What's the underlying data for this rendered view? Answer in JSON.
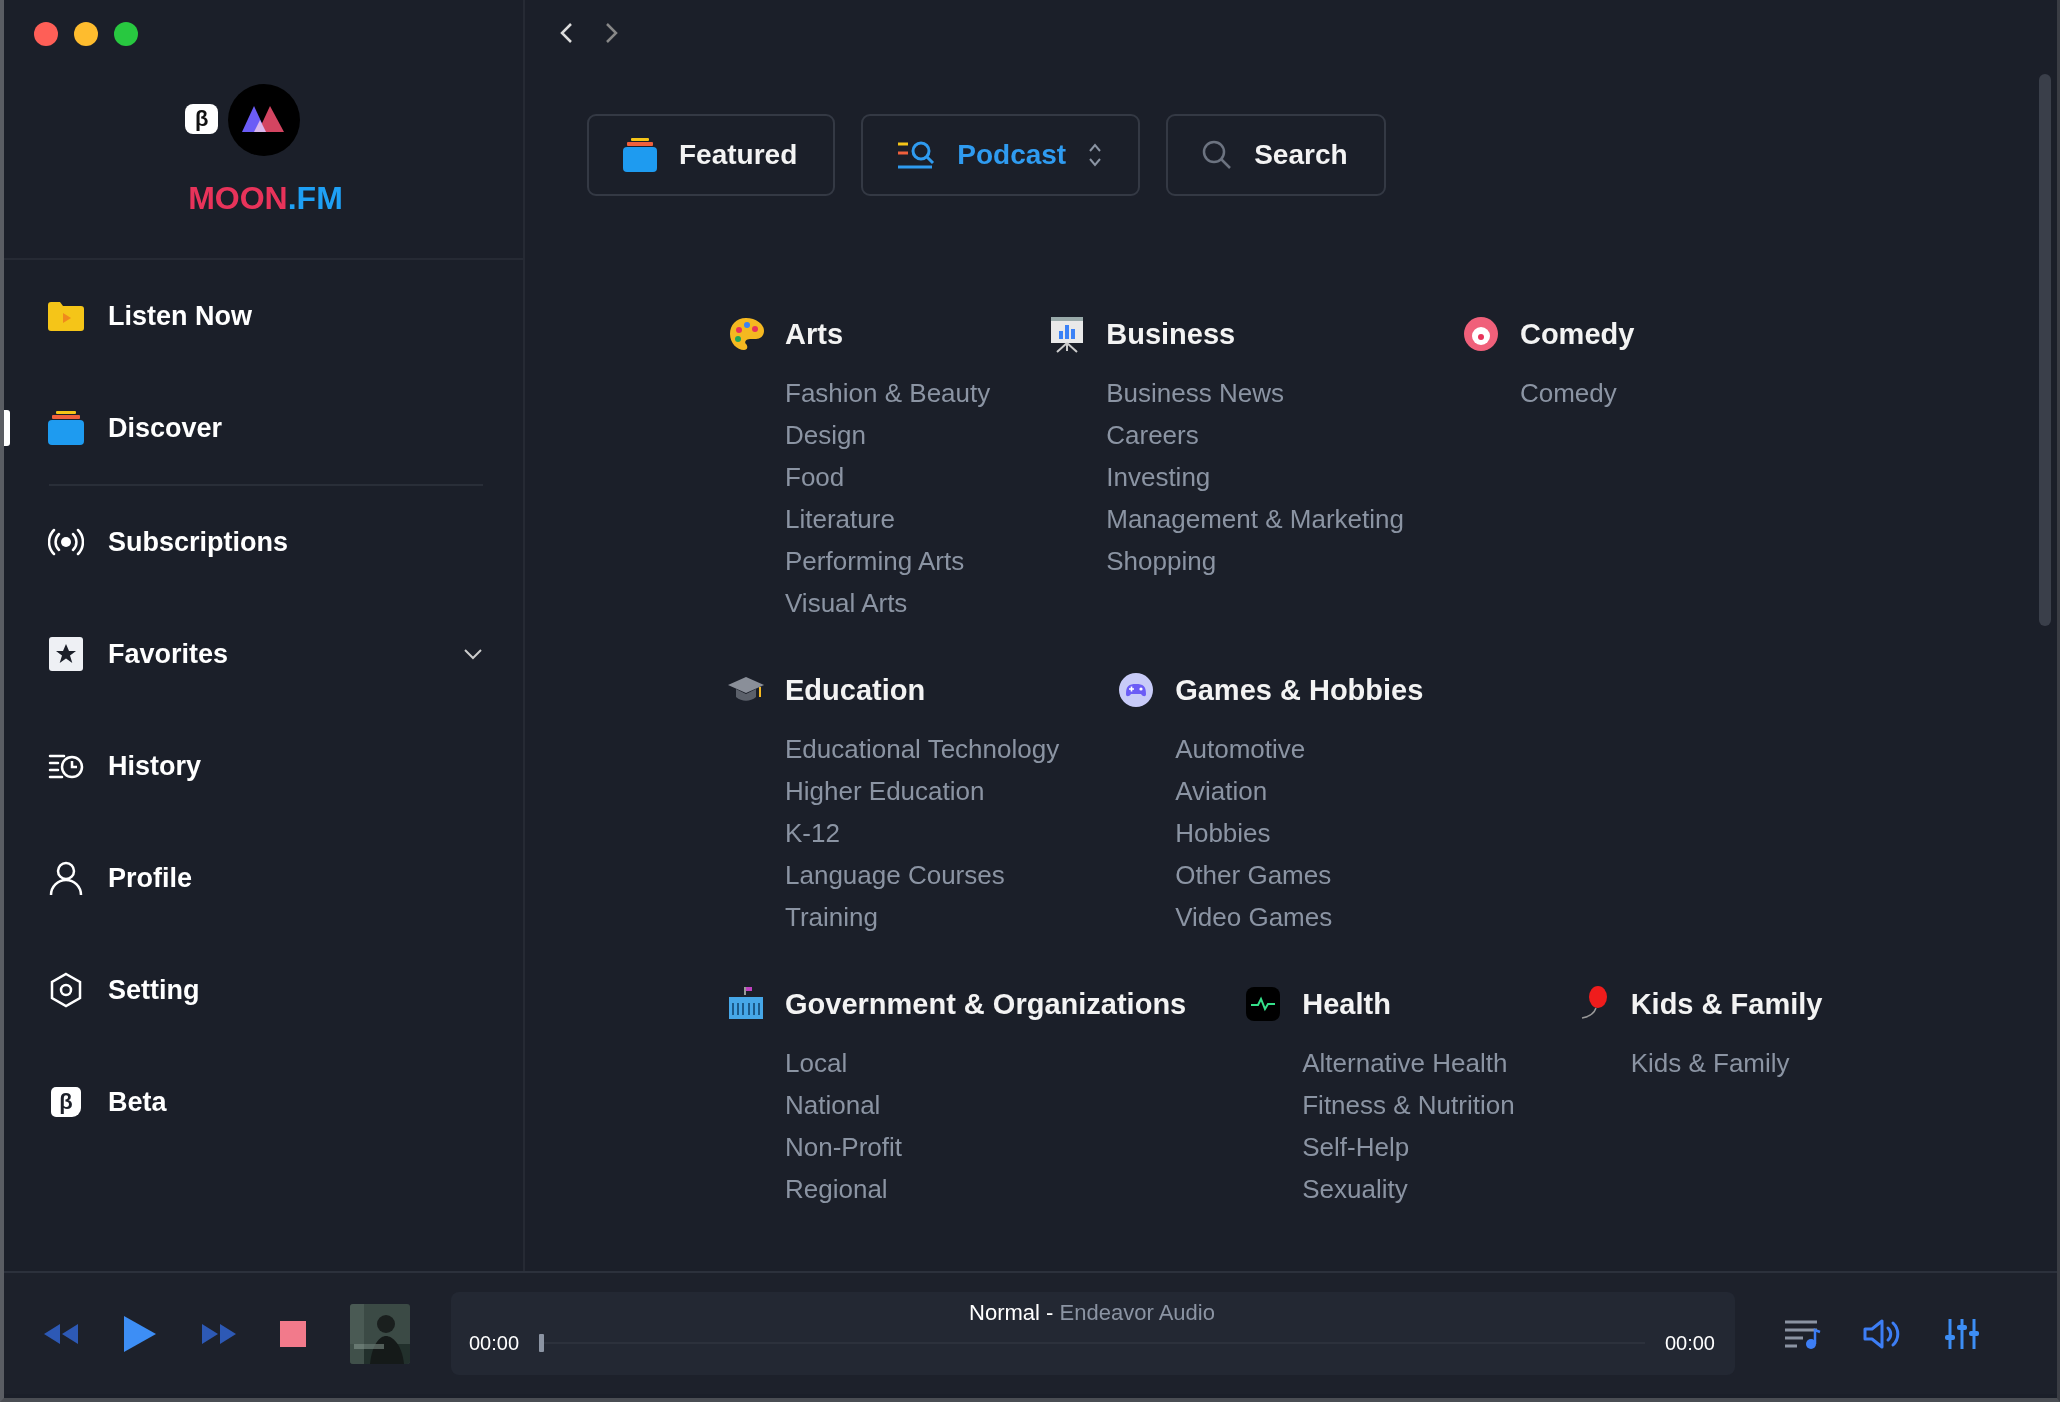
{
  "sidebar": {
    "logo_badge": "β",
    "brand": {
      "main": "MOON",
      "suffix": ".FM"
    },
    "sections": [
      {
        "items": [
          {
            "label": "Listen Now",
            "kind": "link",
            "selected": false
          },
          {
            "label": "Discover",
            "kind": "link",
            "selected": true
          }
        ]
      },
      {
        "items": [
          {
            "label": "Subscriptions",
            "kind": "link",
            "selected": false
          },
          {
            "label": "Favorites",
            "kind": "group",
            "selected": false
          },
          {
            "label": "History",
            "kind": "link",
            "selected": false
          },
          {
            "label": "Profile",
            "kind": "link",
            "selected": false
          },
          {
            "label": "Setting",
            "kind": "link",
            "selected": false
          },
          {
            "label": "Beta",
            "kind": "link",
            "selected": false,
            "icon_text": "β"
          }
        ]
      }
    ]
  },
  "tabs": [
    {
      "label": "Featured",
      "kind": "tab",
      "selected": false
    },
    {
      "label": "Podcast",
      "kind": "dropdown",
      "selected": true
    },
    {
      "label": "Search",
      "kind": "search",
      "selected": false
    }
  ],
  "category_rows": [
    {
      "groups": [
        {
          "title": "Arts",
          "items": [
            "Fashion & Beauty",
            "Design",
            "Food",
            "Literature",
            "Performing Arts",
            "Visual Arts"
          ]
        },
        {
          "title": "Business",
          "items": [
            "Business News",
            "Careers",
            "Investing",
            "Management & Marketing",
            "Shopping"
          ]
        },
        {
          "title": "Comedy",
          "items": [
            "Comedy"
          ]
        }
      ]
    },
    {
      "groups": [
        {
          "title": "Education",
          "items": [
            "Educational Technology",
            "Higher Education",
            "K-12",
            "Language Courses",
            "Training"
          ]
        },
        {
          "title": "Games & Hobbies",
          "items": [
            "Automotive",
            "Aviation",
            "Hobbies",
            "Other Games",
            "Video Games"
          ]
        }
      ]
    },
    {
      "groups": [
        {
          "title": "Government & Organizations",
          "items": [
            "Local",
            "National",
            "Non-Profit",
            "Regional"
          ]
        },
        {
          "title": "Health",
          "items": [
            "Alternative Health",
            "Fitness & Nutrition",
            "Self-Help",
            "Sexuality"
          ]
        },
        {
          "title": "Kids & Family",
          "items": [
            "Kids & Family"
          ]
        }
      ]
    }
  ],
  "player": {
    "playing": false,
    "mode": "Normal -",
    "source": "Endeavor Audio",
    "elapsed": "00:00",
    "duration": "00:00",
    "level": 0
  }
}
